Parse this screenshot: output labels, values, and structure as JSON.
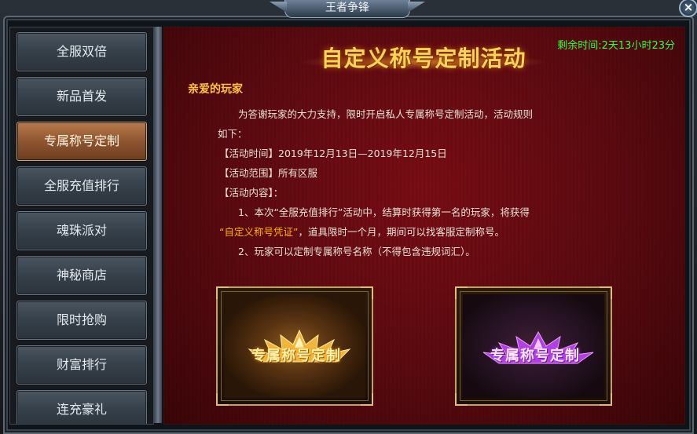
{
  "window": {
    "title": "王者争锋",
    "close_label": "×"
  },
  "sidebar": {
    "items": [
      {
        "label": "全服双倍",
        "active": false
      },
      {
        "label": "新品首发",
        "active": false
      },
      {
        "label": "专属称号定制",
        "active": true
      },
      {
        "label": "全服充值排行",
        "active": false
      },
      {
        "label": "魂珠派对",
        "active": false
      },
      {
        "label": "神秘商店",
        "active": false
      },
      {
        "label": "限时抢购",
        "active": false
      },
      {
        "label": "财富排行",
        "active": false
      },
      {
        "label": "连充豪礼",
        "active": false
      }
    ]
  },
  "main": {
    "banner_title": "自定义称号定制活动",
    "timer": "剩余时间:2天13小时23分",
    "greeting": "亲爱的玩家",
    "intro_1": "为答谢玩家的大力支持，限时开启私人专属称号定制活动，活动规则",
    "intro_2": "如下：",
    "time_label": "【活动时间】",
    "time_value": "2019年12月13日—2019年12月15日",
    "range_label": "【活动范围】",
    "range_value": "所有区服",
    "content_label": "【活动内容】：",
    "rule1_part1": "1、本次“全服充值排行”活动中，结算时获得第一名的玩家，将获得",
    "rule1_highlight": "“自定义称号凭证”",
    "rule1_part2": "，道具限时一个月，期间可以找客服定制称号。",
    "rule2": "2、玩家可以定制专属称号名称（不得包含违规词汇）。"
  },
  "cards": [
    {
      "label": "专属称号定制",
      "style": "gold"
    },
    {
      "label": "专属称号定制",
      "style": "purple"
    }
  ],
  "colors": {
    "timer": "#36ff3a",
    "greeting": "#ffc340",
    "highlight": "#ffb200",
    "active_tab": "#8e5530"
  }
}
